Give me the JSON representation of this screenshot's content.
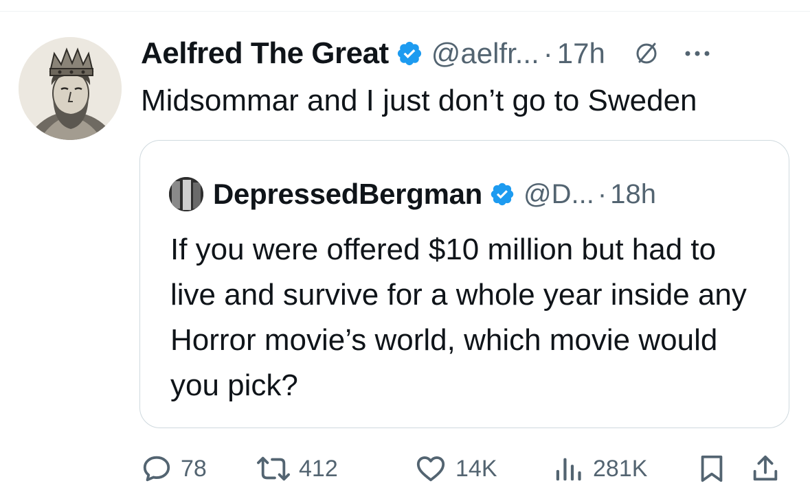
{
  "tweet": {
    "author_name": "Aelfred The Great",
    "handle": "@aelfr...",
    "separator": "·",
    "time": "17h",
    "text": "Midsommar and I just don’t go to Sweden"
  },
  "quoted_tweet": {
    "author_name": "DepressedBergman",
    "handle": "@D...",
    "separator": "·",
    "time": "18h",
    "text": "If you were offered $10 million but had to live and survive for a whole year inside any Horror movie’s world, which movie would you pick?"
  },
  "actions": {
    "replies": "78",
    "reposts": "412",
    "likes": "14K",
    "views": "281K"
  },
  "icons": {
    "verified": "verified-badge-icon",
    "grok": "grok-icon",
    "more": "more-icon",
    "reply": "reply-icon",
    "repost": "repost-icon",
    "like": "heart-icon",
    "views": "views-icon",
    "bookmark": "bookmark-icon",
    "share": "share-icon"
  },
  "colors": {
    "verified": "#1d9bf0",
    "text": "#0f1419",
    "secondary": "#536471",
    "border": "#cfd9de"
  }
}
